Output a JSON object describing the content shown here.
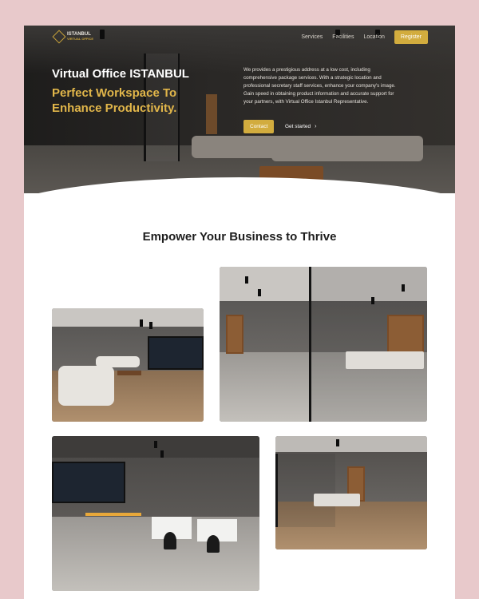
{
  "brand": {
    "name": "ISTANBUL",
    "tagline": "VIRTUAL OFFICE"
  },
  "nav": {
    "items": [
      "Services",
      "Facilities",
      "Location"
    ],
    "register_label": "Register"
  },
  "hero": {
    "title": "Virtual Office ISTANBUL",
    "subtitle": "Perfect Workspace To Enhance Productivity.",
    "description": "We provides a prestigious address at a low cost, including comprehensive package services. With a strategic location and professional secretary staff services, enhance your company's image. Gain speed in obtaining product information and accurate support for your partners, with Virtual Office Istanbul Representative.",
    "contact_label": "Contact",
    "started_label": "Get started"
  },
  "section": {
    "title": "Empower Your Business to Thrive"
  },
  "colors": {
    "accent": "#d2ac3e",
    "subtitle": "#e1b64a",
    "page_bg": "#e8c9cb"
  },
  "icons": {
    "logo": "diamond-logo-icon",
    "get_started": "chevron-right-icon"
  }
}
